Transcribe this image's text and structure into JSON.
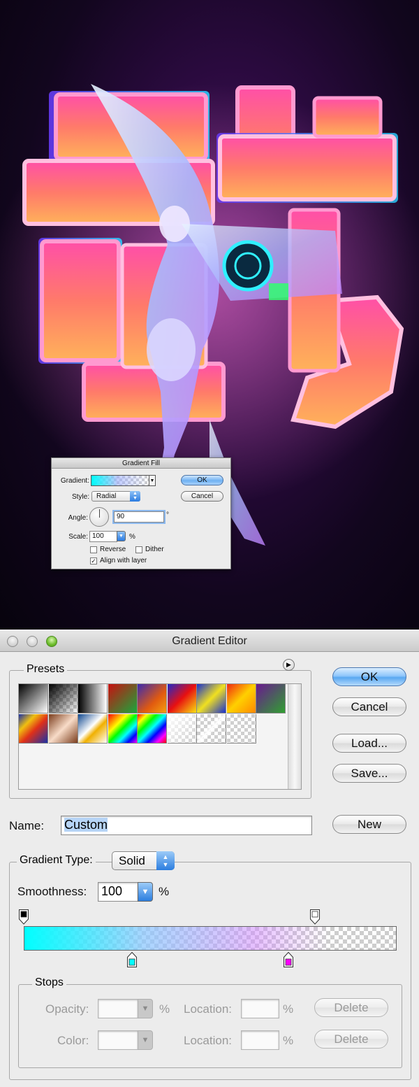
{
  "gradient_fill": {
    "title": "Gradient Fill",
    "gradient_label": "Gradient:",
    "style_label": "Style:",
    "style_value": "Radial",
    "angle_label": "Angle:",
    "angle_value": "90",
    "degree_symbol": "°",
    "scale_label": "Scale:",
    "scale_value": "100",
    "percent": "%",
    "reverse_label": "Reverse",
    "dither_label": "Dither",
    "align_label": "Align with layer",
    "reverse_checked": false,
    "dither_checked": false,
    "align_checked": true,
    "ok_label": "OK",
    "cancel_label": "Cancel"
  },
  "gradient_editor": {
    "title": "Gradient Editor",
    "presets_label": "Presets",
    "ok_label": "OK",
    "cancel_label": "Cancel",
    "load_label": "Load...",
    "save_label": "Save...",
    "name_label": "Name:",
    "name_value": "Custom",
    "new_label": "New",
    "gradient_type_label": "Gradient Type:",
    "gradient_type_value": "Solid",
    "smoothness_label": "Smoothness:",
    "smoothness_value": "100",
    "percent": "%",
    "stops_label": "Stops",
    "opacity_label": "Opacity:",
    "color_label": "Color:",
    "location_label": "Location:",
    "delete_label": "Delete",
    "color_stops": [
      {
        "location": 29,
        "color": "#00ffff"
      },
      {
        "location": 71,
        "color": "#ff00ff"
      }
    ],
    "opacity_stops": [
      {
        "location": 0,
        "opacity": 100
      },
      {
        "location": 78,
        "opacity": 0
      }
    ],
    "presets": [
      "linear-gradient(135deg,#000 0%,#fff 100%)",
      "linear-gradient(135deg,#000 0%,rgba(0,0,0,0) 100%)",
      "linear-gradient(90deg,#000 0%,#fff 100%)",
      "linear-gradient(135deg,#c81010 0%,#18a83c 100%)",
      "linear-gradient(135deg,#3a2ab0 0%,#e05a10 60%,#f5a010 100%)",
      "linear-gradient(135deg,#2028c8 0%,#e81010 50%,#f8e010 100%)",
      "linear-gradient(135deg,#1830d0 0%,#f0e020 50%,#1830d0 100%)",
      "linear-gradient(135deg,#f02810 0%,#ffd000 50%,#ff8800 100%)",
      "linear-gradient(135deg,#6a1890 0%,#30a030 100%)",
      "linear-gradient(135deg,#1830a8 0%,#f0c010 30%,#e03018 55%,#1830a8 100%)",
      "linear-gradient(135deg,#7a3c1c 0%,#f8dcc8 50%,#7a3c1c 100%)",
      "linear-gradient(135deg,#104890 0%,#ffffff 45%,#f0b000 60%,#ffffff 100%)",
      "linear-gradient(135deg,#ff0000,#ff8000,#ffff00,#00ff00,#00ffff,#0000ff,#ff00ff)",
      "linear-gradient(135deg,#ff0000,#ffff00,#00ff00,#00ffff,#0000ff,#ff00ff,#ff0000)",
      "linear-gradient(135deg,#ffffff 0%,rgba(255,255,255,0) 100%)",
      "linear-gradient(135deg,rgba(255,255,255,0) 40%,#ffffff 50%,rgba(255,255,255,0) 60%)",
      "linear-gradient(135deg,rgba(255,255,255,0) 0%,rgba(255,255,255,0) 100%)"
    ]
  }
}
